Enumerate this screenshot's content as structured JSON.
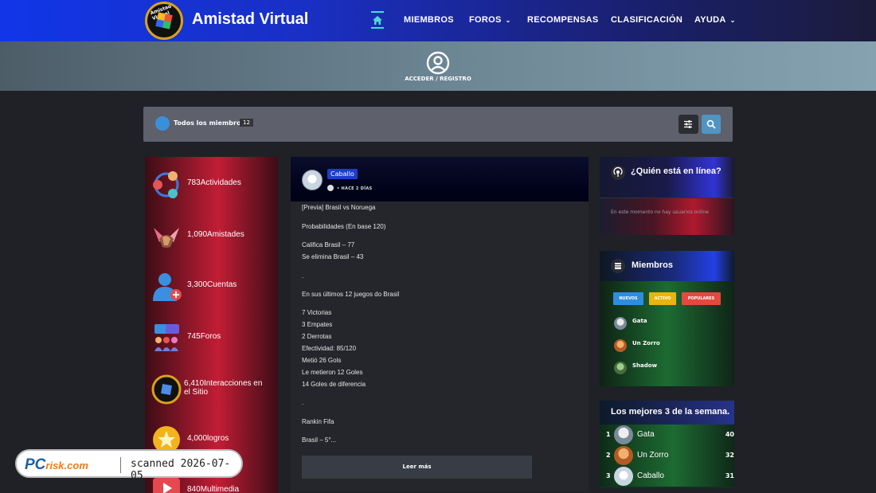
{
  "header": {
    "brand": "Amistad Virtual",
    "logo_text": "Amistad Virtual",
    "nav": [
      "MIEMBROS",
      "FOROS",
      "RECOMPENSAS",
      "CLASIFICACIÓN",
      "AYUDA"
    ],
    "accent_color": "#4dd9d9"
  },
  "hero": {
    "login_label": "ACCEDER / REGISTRO"
  },
  "filter_bar": {
    "label": "Todos los miembros",
    "count": "12"
  },
  "stats": [
    {
      "value": "783",
      "label": "Actividades"
    },
    {
      "value": "1,090",
      "label": "Amistades"
    },
    {
      "value": "3,300",
      "label": "Cuentas"
    },
    {
      "value": "745",
      "label": "Foros"
    },
    {
      "value": "6,410",
      "label": "Interacciones en el Sitio"
    },
    {
      "value": "4,000",
      "label": "logros"
    },
    {
      "value": "840",
      "label": "Multimedia"
    }
  ],
  "post": {
    "author": "Caballo",
    "time": "HACE 2 DÍAS",
    "lines": [
      "[Previa] Brasil vs Noruega",
      "Probabilidades (En base 120)",
      "Califica Brasil – 77",
      "Se elimina Brasil – 43",
      ".",
      "En sus últimos 12 juegos do Brasil",
      "7 Victorias",
      "3 Empates",
      "2 Derrotas",
      "Efectividad: 85/120",
      "Metió 26 Gols",
      "Le metieron 12 Goles",
      "14 Goles de diferencia",
      ".",
      "Rankin Fifa",
      "Brasil – 5°..."
    ],
    "read_more": "Leer más"
  },
  "online_widget": {
    "title": "¿Quién está en línea?",
    "empty_text": "En este momento no hay usuarios online"
  },
  "members_widget": {
    "title": "Miembros",
    "tabs": [
      "NUEVOS",
      "ACTIVO",
      "POPULARES"
    ],
    "tab_colors": [
      "#2f8de0",
      "#e8b50f",
      "#e5483e"
    ],
    "members": [
      "Gata",
      "Un Zorro",
      "Shadow"
    ]
  },
  "best_widget": {
    "title": "Los mejores 3 de la semana.",
    "rows": [
      {
        "rank": "1",
        "name": "Gata",
        "points": "40"
      },
      {
        "rank": "2",
        "name": "Un Zorro",
        "points": "32"
      },
      {
        "rank": "3",
        "name": "Caballo",
        "points": "31"
      }
    ]
  },
  "watermark": {
    "logo_main": "PC",
    "logo_sub": "risk.com",
    "text": "scanned 2026-07-05"
  }
}
